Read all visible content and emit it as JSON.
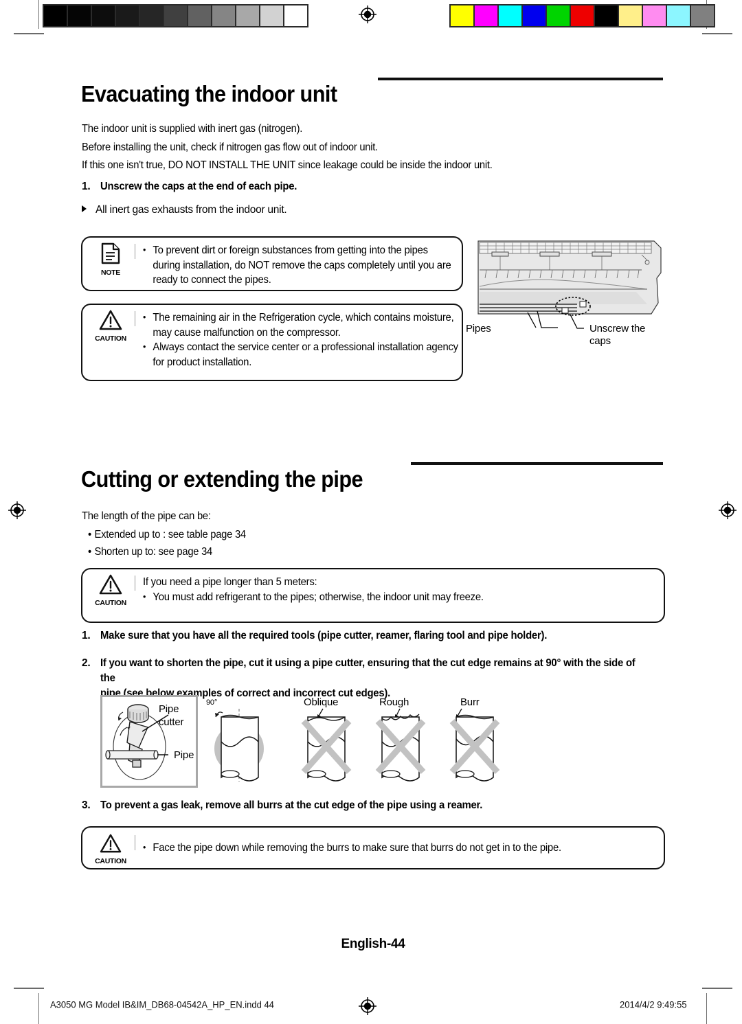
{
  "press_marks": {
    "grey_swatches": [
      "#000000",
      "#050505",
      "#0d0d0d",
      "#1a1a1a",
      "#262626",
      "#404040",
      "#616161",
      "#858585",
      "#a8a8a8",
      "#d2d2d2",
      "#ffffff"
    ],
    "color_swatches": [
      "#ffff00",
      "#ff00ff",
      "#00ffff",
      "#0000ee",
      "#00d400",
      "#ee0000",
      "#000000",
      "#ffef8a",
      "#ff8cf0",
      "#8cf6ff",
      "#808080"
    ],
    "registration_icon": "registration-target-icon"
  },
  "sections": [
    {
      "id": "evacuating",
      "title": "Evacuating the indoor unit",
      "intro": [
        "The indoor unit is supplied with inert gas  (nitrogen).",
        "Before installing the unit, check if nitrogen gas flow out of indoor unit.",
        "If this one isn't true, DO NOT INSTALL THE UNIT since leakage could be inside the indoor unit."
      ],
      "step": {
        "number": "1.",
        "text": "Unscrew the caps at the end of each pipe."
      },
      "arrow_note": "All inert gas exhausts from the indoor unit.",
      "note_box": {
        "icon": "note-document-icon",
        "caption": "NOTE",
        "lines": [
          {
            "bullet": true,
            "text": "To prevent dirt or foreign substances from getting into the pipes"
          },
          {
            "bullet": false,
            "text": "during installation, do NOT remove the caps completely until you are"
          },
          {
            "bullet": false,
            "text": "ready to connect the pipes."
          }
        ]
      },
      "caution_box": {
        "icon": "caution-triangle-icon",
        "caption": "CAUTION",
        "lines": [
          {
            "bullet": true,
            "text": "The remaining air in the Refrigeration cycle, which contains moisture,"
          },
          {
            "bullet": false,
            "text": "may cause malfunction on the compressor."
          },
          {
            "bullet": true,
            "text": "Always contact the service center or a professional installation agency"
          },
          {
            "bullet": false,
            "text": "for product installation."
          }
        ]
      },
      "figure": {
        "name": "indoor-unit-pipes-illustration",
        "labels": [
          {
            "text": "Pipes"
          },
          {
            "text": "Unscrew the"
          },
          {
            "text": "caps"
          }
        ]
      }
    },
    {
      "id": "cutting",
      "title": "Cutting or extending the pipe",
      "intro": [
        "The length of the pipe can be:"
      ],
      "bullets": [
        "Extended up to : see table page 34",
        "Shorten up to: see page 34"
      ],
      "caution_box": {
        "icon": "caution-triangle-icon",
        "caption": "CAUTION",
        "lines": [
          {
            "bullet": false,
            "text": "If you need a pipe longer than 5 meters:"
          },
          {
            "bullet": true,
            "text": "You must add refrigerant to the pipes; otherwise, the indoor unit may freeze."
          }
        ]
      },
      "steps": [
        {
          "number": "1.",
          "lines": [
            "Make sure that you have all the required tools (pipe cutter, reamer, flaring tool and pipe holder)."
          ]
        },
        {
          "number": "2.",
          "lines": [
            "If you want to shorten the pipe, cut it using a pipe cutter, ensuring that the cut edge remains at 90° with the side of the",
            "pipe (see below examples of correct and incorrect cut edges)."
          ]
        },
        {
          "number": "3.",
          "lines": [
            "To prevent a gas leak, remove all burrs at the cut edge of the pipe using a reamer."
          ]
        }
      ],
      "cutter_figure": {
        "name": "pipe-cutter-illustration",
        "labels": [
          "Pipe",
          "cutter",
          "Pipe"
        ]
      },
      "cut_edge_figures": [
        {
          "name": "cut-edge-correct",
          "label": "90°",
          "mark": "check"
        },
        {
          "name": "cut-edge-oblique",
          "label": "Oblique",
          "mark": "cross"
        },
        {
          "name": "cut-edge-rough",
          "label": "Rough",
          "mark": "cross"
        },
        {
          "name": "cut-edge-burr",
          "label": "Burr",
          "mark": "cross"
        }
      ],
      "final_caution_box": {
        "icon": "caution-triangle-icon",
        "caption": "CAUTION",
        "lines": [
          {
            "bullet": true,
            "text": "Face the pipe down while removing the burrs to make sure that burrs do not get in to the pipe."
          }
        ]
      }
    }
  ],
  "footer": {
    "page_label": "English-44",
    "file_name": "A3050 MG Model IB&IM_DB68-04542A_HP_EN.indd   44",
    "timestamp": "2014/4/2   9:49:55"
  }
}
